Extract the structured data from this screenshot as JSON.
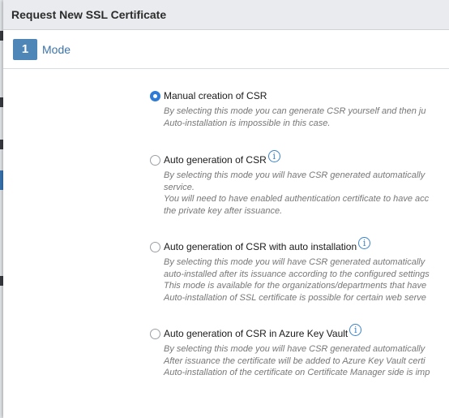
{
  "dialog": {
    "title": "Request New SSL Certificate"
  },
  "step": {
    "number": "1",
    "label": "Mode"
  },
  "options": [
    {
      "label": "Manual creation of CSR",
      "checked": true,
      "has_info": false,
      "desc": [
        "By selecting this mode you can generate CSR yourself and then ju",
        "Auto-installation is impossible in this case."
      ]
    },
    {
      "label": "Auto generation of CSR",
      "checked": false,
      "has_info": true,
      "desc": [
        "By selecting this mode you will have CSR generated automatically",
        "service.",
        "You will need to have enabled authentication certificate to have acc",
        "the private key after issuance."
      ]
    },
    {
      "label": "Auto generation of CSR with auto installation",
      "checked": false,
      "has_info": true,
      "desc": [
        "By selecting this mode you will have CSR generated automatically",
        "auto-installed after its issuance according to the configured settings",
        "This mode is available for the organizations/departments that have",
        "Auto-installation of SSL certificate is possible for certain web serve"
      ]
    },
    {
      "label": "Auto generation of CSR in Azure Key Vault",
      "checked": false,
      "has_info": true,
      "desc": [
        "By selecting this mode you will have CSR generated automatically",
        "After issuance the certificate will be added to Azure Key Vault certi",
        "Auto-installation of the certificate on Certificate Manager side is imp"
      ]
    }
  ],
  "icons": {
    "info": "info-circle-icon",
    "info_glyph": "i"
  },
  "colors": {
    "accent": "#4e86b8",
    "radio_checked": "#2f7bd6",
    "desc_text": "#777777"
  }
}
